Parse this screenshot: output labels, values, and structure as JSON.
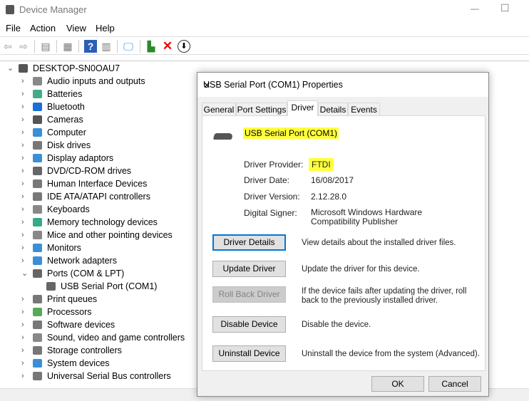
{
  "window": {
    "title": "Device Manager",
    "minimize": "—",
    "maximize": "☐"
  },
  "menu": [
    "File",
    "Action",
    "View",
    "Help"
  ],
  "tree": {
    "root": "DESKTOP-SN0OAU7",
    "items": [
      {
        "label": "Audio inputs and outputs",
        "color": "#888"
      },
      {
        "label": "Batteries",
        "color": "#4a8"
      },
      {
        "label": "Bluetooth",
        "color": "#1a6fd6"
      },
      {
        "label": "Cameras",
        "color": "#555"
      },
      {
        "label": "Computer",
        "color": "#3a8fd6"
      },
      {
        "label": "Disk drives",
        "color": "#777"
      },
      {
        "label": "Display adaptors",
        "color": "#3a8fd6"
      },
      {
        "label": "DVD/CD-ROM drives",
        "color": "#666"
      },
      {
        "label": "Human Interface Devices",
        "color": "#777"
      },
      {
        "label": "IDE ATA/ATAPI controllers",
        "color": "#777"
      },
      {
        "label": "Keyboards",
        "color": "#888"
      },
      {
        "label": "Memory technology devices",
        "color": "#3a8"
      },
      {
        "label": "Mice and other pointing devices",
        "color": "#888"
      },
      {
        "label": "Monitors",
        "color": "#3a8fd6"
      },
      {
        "label": "Network adapters",
        "color": "#3a8fd6"
      },
      {
        "label": "Ports (COM & LPT)",
        "color": "#666",
        "expanded": true
      },
      {
        "label": "USB Serial Port (COM1)",
        "color": "#666",
        "child": true
      },
      {
        "label": "Print queues",
        "color": "#777"
      },
      {
        "label": "Processors",
        "color": "#5a5"
      },
      {
        "label": "Software devices",
        "color": "#777"
      },
      {
        "label": "Sound, video and game controllers",
        "color": "#888"
      },
      {
        "label": "Storage controllers",
        "color": "#777"
      },
      {
        "label": "System devices",
        "color": "#3a8fd6"
      },
      {
        "label": "Universal Serial Bus controllers",
        "color": "#777"
      }
    ]
  },
  "dialog": {
    "title": "USB Serial Port (COM1) Properties",
    "close": "✕",
    "tabs": [
      "General",
      "Port Settings",
      "Driver",
      "Details",
      "Events"
    ],
    "device_name": "USB Serial Port (COM1)",
    "fields": [
      {
        "label": "Driver Provider:",
        "value": "FTDI"
      },
      {
        "label": "Driver Date:",
        "value": "16/08/2017"
      },
      {
        "label": "Driver Version:",
        "value": "2.12.28.0"
      },
      {
        "label": "Digital Signer:",
        "value": "Microsoft Windows Hardware Compatibility Publisher"
      }
    ],
    "buttons": [
      {
        "label": "Driver Details",
        "desc": "View details about the installed driver files."
      },
      {
        "label": "Update Driver",
        "desc": "Update the driver for this device."
      },
      {
        "label": "Roll Back Driver",
        "desc": "If the device fails after updating the driver, roll back to the previously installed driver."
      },
      {
        "label": "Disable Device",
        "desc": "Disable the device."
      },
      {
        "label": "Uninstall Device",
        "desc": "Uninstall the device from the system (Advanced)."
      }
    ],
    "ok": "OK",
    "cancel": "Cancel"
  }
}
